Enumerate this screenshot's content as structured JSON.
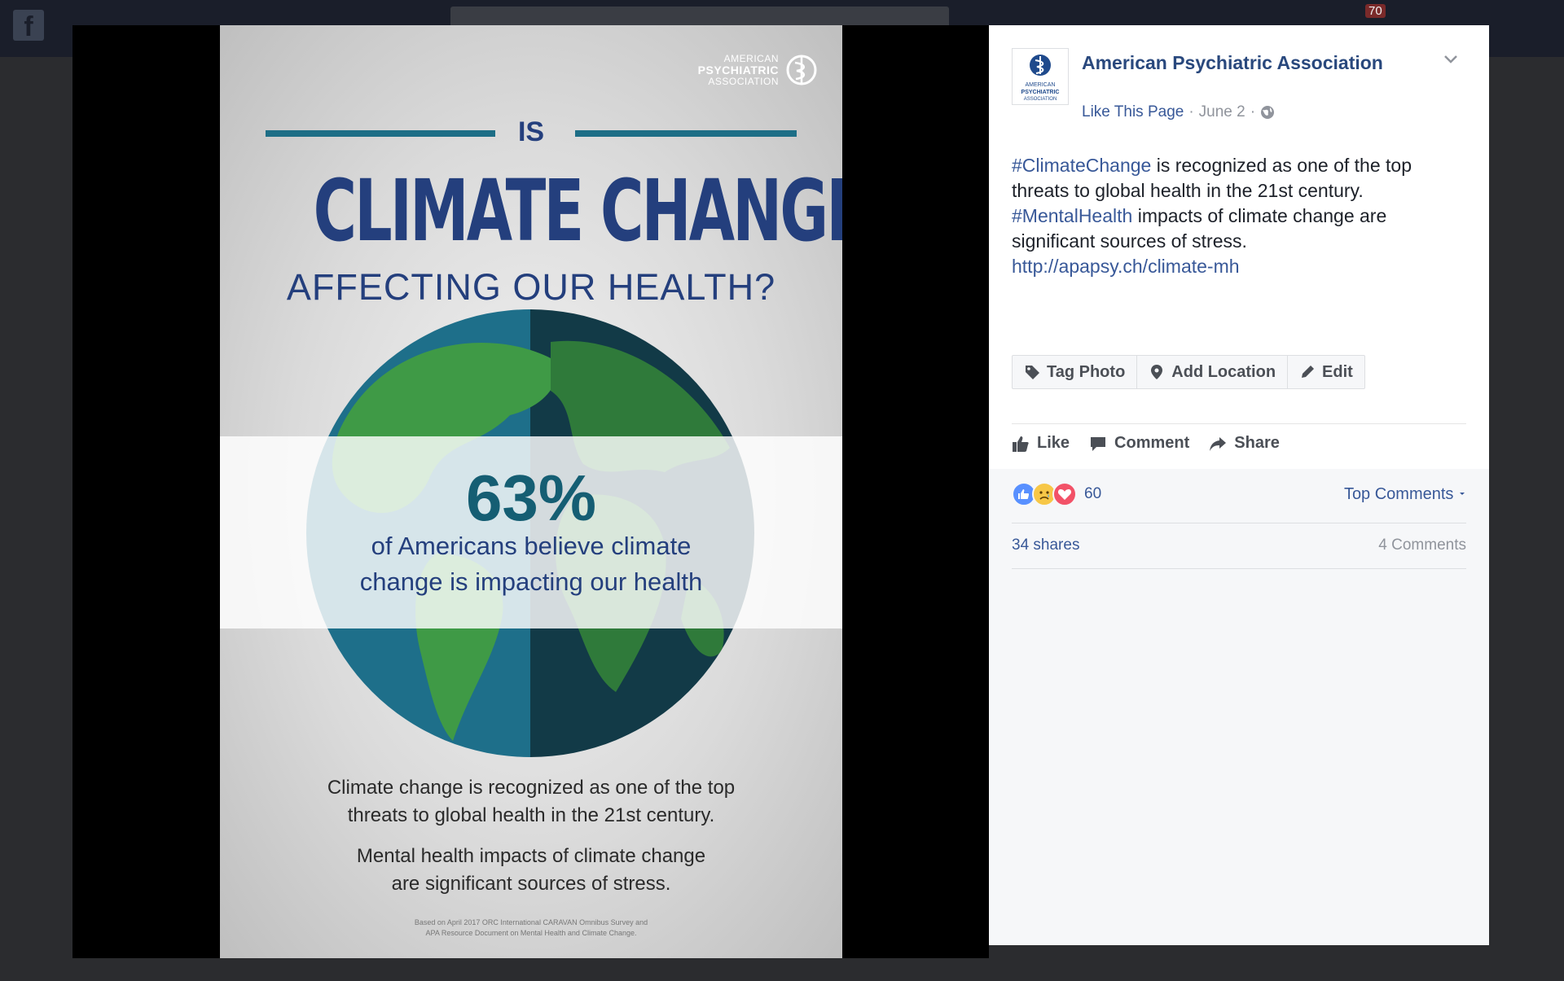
{
  "topbar": {
    "logo_glyph": "f",
    "notif_count": "70"
  },
  "poster": {
    "logo_line1": "AMERICAN",
    "logo_line2": "PSYCHIATRIC",
    "logo_line3": "ASSOCIATION",
    "is": "IS",
    "headline": "CLIMATE CHANGE",
    "subheadline": "AFFECTING OUR HEALTH?",
    "stat_percent": "63%",
    "stat_caption_line1": "of Americans believe climate",
    "stat_caption_line2": "change is impacting our health",
    "para1_line1": "Climate change is recognized as one of the top",
    "para1_line2": "threats to global health in the 21st century.",
    "para2_line1": "Mental health impacts of climate change",
    "para2_line2": "are significant sources of stress.",
    "source_line1": "Based on April 2017 ORC International CARAVAN Omnibus Survey and",
    "source_line2": "APA Resource Document on Mental Health and Climate Change."
  },
  "sidebar": {
    "page_name": "American Psychiatric Association",
    "avatar_line1": "AMERICAN",
    "avatar_line2": "PSYCHIATRIC",
    "avatar_line3": "ASSOCIATION",
    "like_page": "Like This Page",
    "sep1": "·",
    "date": "June 2",
    "sep2": "·",
    "post": {
      "hashtag1": "#ClimateChange",
      "text1": " is recognized as one of the top threats to global health in the 21st century. ",
      "hashtag2": "#MentalHealth",
      "text2": " impacts of climate change are significant sources of stress. ",
      "link": "http://apapsy.ch/climate-mh"
    },
    "photo_actions": {
      "tag": "Tag Photo",
      "location": "Add Location",
      "edit": "Edit"
    },
    "ufi": {
      "like": "Like",
      "comment": "Comment",
      "share": "Share"
    },
    "reactions_count": "60",
    "top_comments": "Top Comments",
    "shares": "34 shares",
    "comments": "4 Comments"
  },
  "colors": {
    "fb_link": "#385898",
    "apa_navy": "#243f7d",
    "apa_teal": "#1d6e86"
  }
}
